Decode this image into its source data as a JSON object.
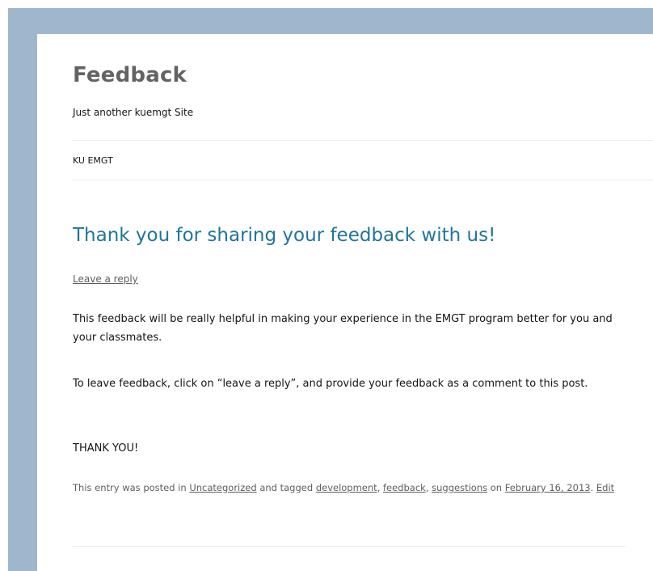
{
  "site": {
    "title": "Feedback",
    "description": "Just another kuemgt Site"
  },
  "nav": {
    "items": [
      {
        "label": "KU EMGT"
      }
    ]
  },
  "post": {
    "title": "Thank you for sharing your feedback with us!",
    "reply_link": "Leave a reply",
    "paragraphs": [
      "This feedback will be really helpful in making your experience in the EMGT program better for you and your classmates.",
      "To leave feedback, click on “leave a reply”, and provide your feedback as a comment to this post.",
      "THANK YOU!"
    ],
    "meta": {
      "prefix": "This entry was posted in ",
      "category": "Uncategorized",
      "tagged_text": " and tagged ",
      "tags": [
        "development",
        "feedback",
        "suggestions"
      ],
      "tag_separator": ", ",
      "on_text": " on ",
      "date": "February 16, 2013",
      "after_date": ". ",
      "edit": "Edit"
    }
  },
  "colors": {
    "background_band": "#9fb6cd",
    "title_link": "#21759b",
    "site_title": "#636363",
    "text": "#141412",
    "muted": "#5e5e5e",
    "divider": "#ededed"
  }
}
